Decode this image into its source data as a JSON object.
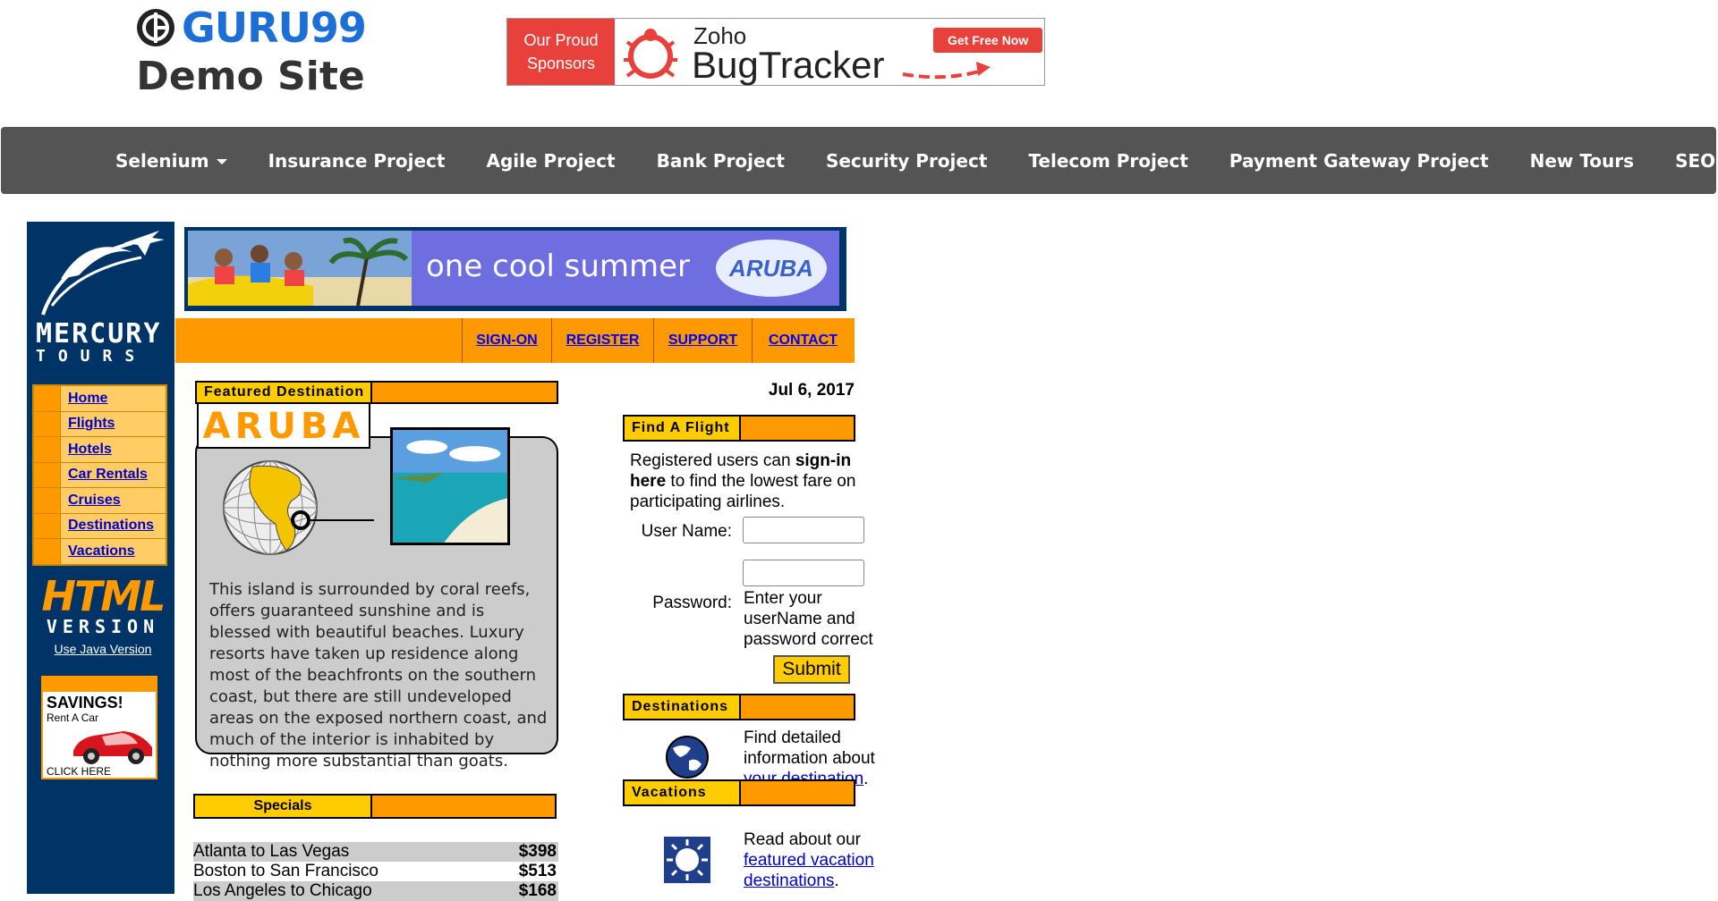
{
  "header": {
    "logo_text": "GURU99",
    "subtitle": "Demo Site",
    "ad": {
      "left_line1": "Our Proud",
      "left_line2": "Sponsors",
      "brand": "Zoho",
      "product": "BugTracker",
      "cta": "Get Free Now"
    }
  },
  "nav": {
    "items": [
      {
        "label": "Selenium",
        "dropdown": true
      },
      {
        "label": "Insurance Project"
      },
      {
        "label": "Agile Project"
      },
      {
        "label": "Bank Project"
      },
      {
        "label": "Security Project"
      },
      {
        "label": "Telecom Project"
      },
      {
        "label": "Payment Gateway Project"
      },
      {
        "label": "New Tours"
      },
      {
        "label": "SEO",
        "dropdown": true
      }
    ]
  },
  "mercury": {
    "logo_line1": "MERCURY",
    "logo_line2": "TOURS",
    "side_nav": [
      "Home",
      "Flights",
      "Hotels",
      "Car Rentals",
      "Cruises",
      "Destinations",
      "Vacations"
    ],
    "html_version": {
      "line1": "HTML",
      "line2": "VERSION",
      "java_link": "Use Java Version"
    },
    "rent_ad": {
      "title": "SAVINGS!",
      "sub": "Rent A Car",
      "click": "CLICK HERE"
    },
    "banner": {
      "text": "one cool summer",
      "logo": "ARUBA"
    },
    "top_links": [
      "SIGN-ON",
      "REGISTER",
      "SUPPORT",
      "CONTACT"
    ],
    "featured": {
      "title": "Featured Destination",
      "name": "ARUBA",
      "description": "This island is surrounded by coral reefs, offers guaranteed sunshine and is blessed with beautiful beaches. Luxury resorts have taken up residence along most of the beachfronts on the southern coast, but there are still undeveloped areas on the exposed northern coast, and much of the interior is inhabited by nothing more substantial than goats."
    },
    "specials": {
      "title": "Specials",
      "rows": [
        {
          "route": "Atlanta to Las Vegas",
          "price": "$398"
        },
        {
          "route": "Boston to San Francisco",
          "price": "$513"
        },
        {
          "route": "Los Angeles to Chicago",
          "price": "$168"
        }
      ]
    },
    "date": "Jul 6, 2017",
    "find_flight": {
      "title": "Find A Flight",
      "intro_pre": "Registered users can ",
      "intro_bold": "sign-in here",
      "intro_post": " to find the lowest fare on participating airlines.",
      "user_label": "User Name:",
      "password_label": "Password:",
      "password_hint": "Enter your userName and password correct",
      "submit": "Submit"
    },
    "destinations": {
      "title": "Destinations",
      "text_pre": "Find detailed information about ",
      "link": "your destination",
      "text_post": "."
    },
    "vacations": {
      "title": "Vacations",
      "text_pre": "Read about our ",
      "link": "featured vacation destinations",
      "text_post": "."
    }
  }
}
